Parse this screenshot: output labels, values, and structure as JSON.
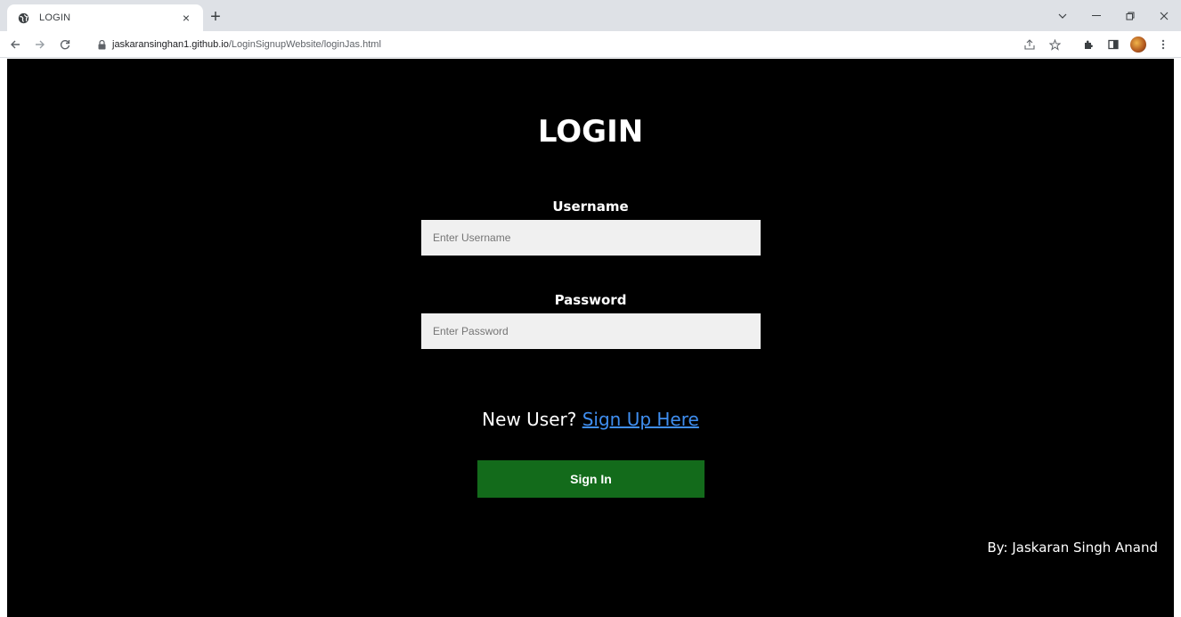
{
  "browser": {
    "tab_title": "LOGIN",
    "tab_close": "×",
    "new_tab": "+",
    "url_host": "jaskaransinghan1.github.io",
    "url_path": "/LoginSignupWebsite/loginJas.html",
    "icons": [
      "globe-icon",
      "lock-icon",
      "back-icon",
      "forward-icon",
      "reload-icon",
      "share-icon",
      "star-icon",
      "extensions-icon",
      "sidepanel-icon",
      "avatar",
      "menu-icon"
    ]
  },
  "page": {
    "title": "LOGIN",
    "username_label": "Username",
    "username_placeholder": "Enter Username",
    "password_label": "Password",
    "password_placeholder": "Enter Password",
    "new_user_text": "New User?",
    "signup_link": "Sign Up Here",
    "signin_button": "Sign In",
    "credit": "By: Jaskaran Singh Anand"
  },
  "colors": {
    "page_background": "#000000",
    "button_background": "#136b1b",
    "link": "#3f8ef0",
    "input_background": "#f0f0f0"
  }
}
